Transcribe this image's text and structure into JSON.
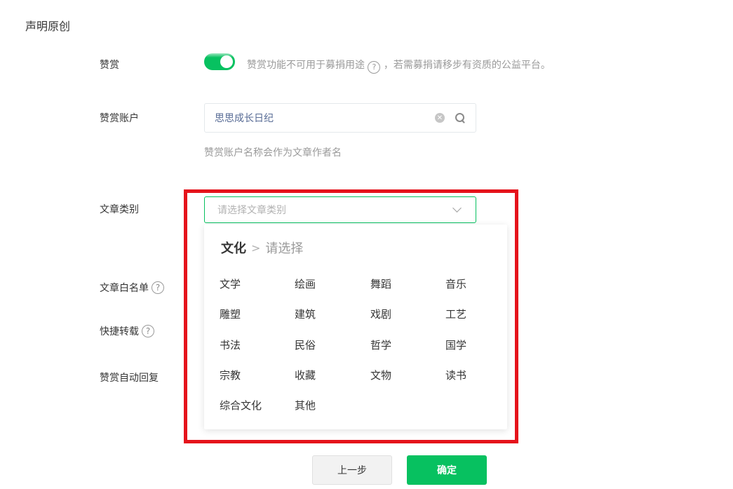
{
  "page": {
    "title": "声明原创"
  },
  "reward": {
    "label": "赞赏",
    "enabled": true,
    "description_before": "赞赏功能不可用于募捐用途",
    "description_after": "，若需募捐请移步有资质的公益平台。",
    "help_glyph": "?"
  },
  "account": {
    "label": "赞赏账户",
    "value": "思思成长日纪",
    "hint": "赞赏账户名称会作为文章作者名"
  },
  "category": {
    "label": "文章类别",
    "placeholder": "请选择文章类别",
    "crumb_current": "文化",
    "crumb_prompt": "请选择",
    "options": [
      "文学",
      "绘画",
      "舞蹈",
      "音乐",
      "雕塑",
      "建筑",
      "戏剧",
      "工艺",
      "书法",
      "民俗",
      "哲学",
      "国学",
      "宗教",
      "收藏",
      "文物",
      "读书",
      "综合文化",
      "其他"
    ]
  },
  "whitelist": {
    "label": "文章白名单",
    "help_glyph": "?"
  },
  "quick_repost": {
    "label": "快捷转载",
    "help_glyph": "?"
  },
  "auto_reply": {
    "label": "赞赏自动回复"
  },
  "buttons": {
    "prev": "上一步",
    "confirm": "确定"
  },
  "colors": {
    "accent": "#07c160",
    "highlight": "#e5131b",
    "link": "#576b95"
  }
}
